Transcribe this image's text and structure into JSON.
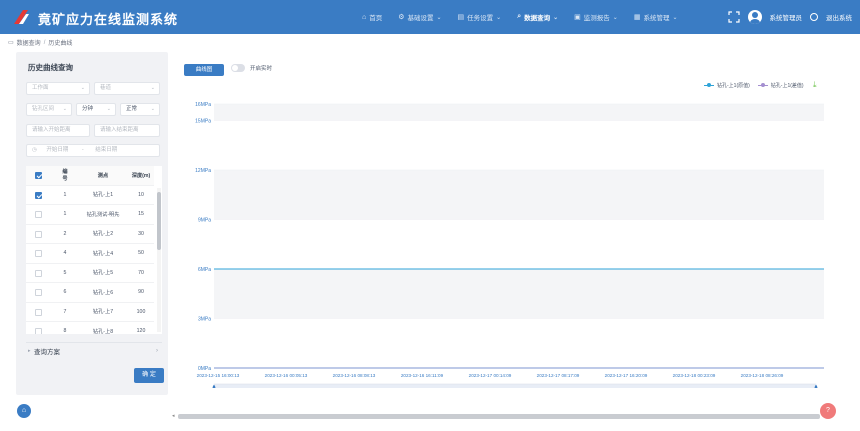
{
  "header": {
    "title": "竟矿应力在线监测系统",
    "nav": [
      {
        "icon": "home-icon",
        "glyph": "⌂",
        "label": "首页",
        "dropdown": false,
        "active": false
      },
      {
        "icon": "settings-icon",
        "glyph": "⚙",
        "label": "基础设置",
        "dropdown": true,
        "active": false
      },
      {
        "icon": "task-icon",
        "glyph": "▤",
        "label": "任务设置",
        "dropdown": true,
        "active": false
      },
      {
        "icon": "search-icon",
        "glyph": "⌕",
        "label": "数据查询",
        "dropdown": true,
        "active": true
      },
      {
        "icon": "monitor-icon",
        "glyph": "▣",
        "label": "监测报告",
        "dropdown": true,
        "active": false
      },
      {
        "icon": "system-icon",
        "glyph": "▦",
        "label": "系统管理",
        "dropdown": true,
        "active": false
      }
    ],
    "user_name": "系统管理员",
    "logout": "退出系统"
  },
  "breadcrumb": [
    "数据查询",
    "历史曲线"
  ],
  "query_panel": {
    "title": "历史曲线查询",
    "workface_placeholder": "工作面",
    "lane_placeholder": "巷道",
    "point_placeholder": "钻孔区间",
    "interval_value": "分钟",
    "status_value": "正常",
    "start_dist_placeholder": "请输入开始距离",
    "end_dist_placeholder": "请输入结束距离",
    "start_date_placeholder": "开始日期",
    "date_sep": "-",
    "end_date_placeholder": "结束日期",
    "columns": [
      "编号",
      "测点",
      "深度(m)"
    ],
    "rows": [
      {
        "no": "1",
        "point": "钻孔-上1",
        "depth": "10",
        "checked": true
      },
      {
        "no": "1",
        "point": "钻孔测试-明先",
        "depth": "15",
        "checked": false
      },
      {
        "no": "2",
        "point": "钻孔-上2",
        "depth": "30",
        "checked": false
      },
      {
        "no": "4",
        "point": "钻孔-上4",
        "depth": "50",
        "checked": false
      },
      {
        "no": "5",
        "point": "钻孔-上5",
        "depth": "70",
        "checked": false
      },
      {
        "no": "6",
        "point": "钻孔-上6",
        "depth": "90",
        "checked": false
      },
      {
        "no": "7",
        "point": "钻孔-上7",
        "depth": "100",
        "checked": false
      },
      {
        "no": "8",
        "point": "钻孔-上8",
        "depth": "120",
        "checked": false
      }
    ],
    "scheme_label": "查询方案",
    "confirm_label": "确 定"
  },
  "toolbar": {
    "chart_button": "曲线图",
    "toggle_label": "开启实时"
  },
  "chart_data": {
    "type": "line",
    "series": [
      {
        "name": "钻孔-上1(原值)",
        "color": "#2ea3d8",
        "values": [
          6.0,
          6.0,
          6.0,
          6.0,
          6.0,
          6.0,
          6.0,
          6.0,
          6.0,
          6.0
        ]
      },
      {
        "name": "钻孔-上1(差值)",
        "color": "#a48fd0",
        "values": [
          0,
          0,
          0,
          0,
          0,
          0,
          0,
          0,
          0,
          0
        ]
      }
    ],
    "x": [
      "2023-12-15 16:00:13",
      "2023-12-16 00:05:13",
      "2023-12-16 08:08:13",
      "2023-12-16 16:11:09",
      "2023-12-17 00:14:09",
      "2023-12-17 08:17:09",
      "2023-12-17 16:20:09",
      "2023-12-18 00:23:09",
      "2023-12-18 08:26:09"
    ],
    "y_ticks": [
      "0MPa",
      "3MPa",
      "6MPa",
      "9MPa",
      "12MPa",
      "15MPa",
      "16MPa"
    ],
    "y_tick_values": [
      0,
      3,
      6,
      9,
      12,
      15,
      16
    ],
    "ylim": [
      0,
      16
    ],
    "grid": true,
    "legend": "top-right"
  },
  "colors": {
    "primary": "#3a7cc4",
    "help": "#f07a7a",
    "download": "#6bc24a"
  }
}
